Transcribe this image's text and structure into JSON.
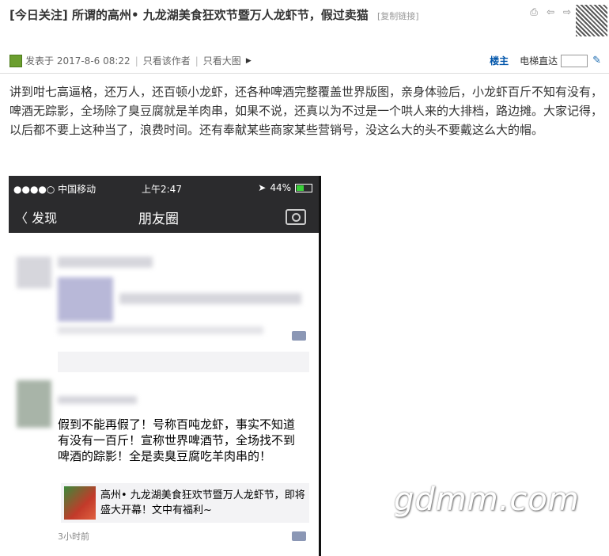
{
  "header": {
    "tag": "[今日关注]",
    "title": "所谓的高州• 九龙湖美食狂欢节暨万人龙虾节，假过卖猫",
    "copy_link": "[复制链接]"
  },
  "meta": {
    "posted": "发表于 2017-8-6 08:22",
    "only_author": "只看该作者",
    "only_images": "只看大图",
    "louzhu": "楼主",
    "goto_floor": "电梯直达"
  },
  "post": {
    "text": "讲到咁七高逼格，还万人，还百顿小龙虾，还各种啤酒完整覆盖世界版图，亲身体验后，小龙虾百斤不知有没有，啤酒无踪影，全场除了臭豆腐就是羊肉串，如果不说，还真以为不过是一个哄人来的大排档，路边摊。大家记得，以后都不要上这种当了，浪费时间。还有奉献某些商家某些营销号，没这么大的头不要戴这么大的帽。"
  },
  "phone": {
    "carrier": "●●●●○ 中国移动",
    "time": "上午2:47",
    "battery": "44%",
    "back": "〈 发现",
    "nav_title": "朋友圈",
    "moment_text": "假到不能再假了！号称百吨龙虾，事实不知道有没有一百斤！宣称世界啤酒节，全场找不到啤酒的踪影！全是卖臭豆腐吃羊肉串的！",
    "link_title": "高州• 九龙湖美食狂欢节暨万人龙虾节，即将盛大开幕！文中有福利~",
    "time_ago": "3小时前"
  },
  "watermark": "gdmm.com"
}
